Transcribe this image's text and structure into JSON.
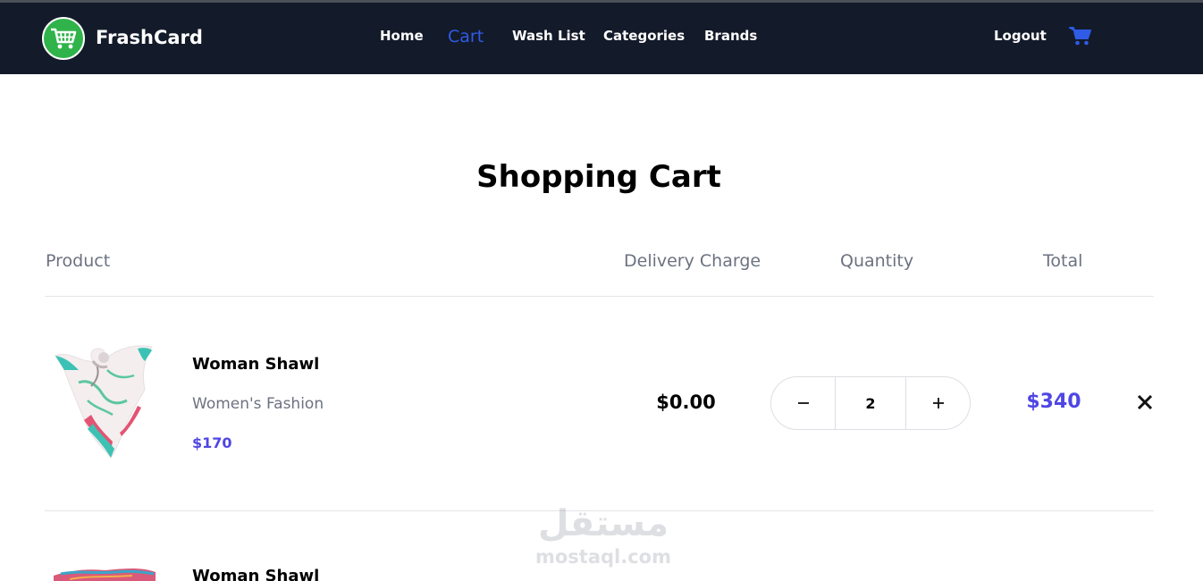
{
  "navbar": {
    "brand": "FrashCard",
    "links": [
      "Home",
      "Cart",
      "Wash List",
      "Categories",
      "Brands"
    ],
    "active": "Cart",
    "logout": "Logout"
  },
  "cart": {
    "title": "Shopping Cart",
    "columns": {
      "product": "Product",
      "delivery": "Delivery Charge",
      "quantity": "Quantity",
      "total": "Total"
    },
    "items": [
      {
        "name": "Woman Shawl",
        "category": "Women's Fashion",
        "price": "$170",
        "delivery": "$0.00",
        "quantity": "2",
        "total": "$340"
      },
      {
        "name": "Woman Shawl"
      }
    ]
  },
  "watermark": {
    "logo_text": "مستقل",
    "site": "mostaql.com"
  },
  "colors": {
    "navbar_bg": "#131a29",
    "accent": "#4f46e5",
    "active_link": "#2f5be6",
    "logo_green": "#2fb34a"
  }
}
